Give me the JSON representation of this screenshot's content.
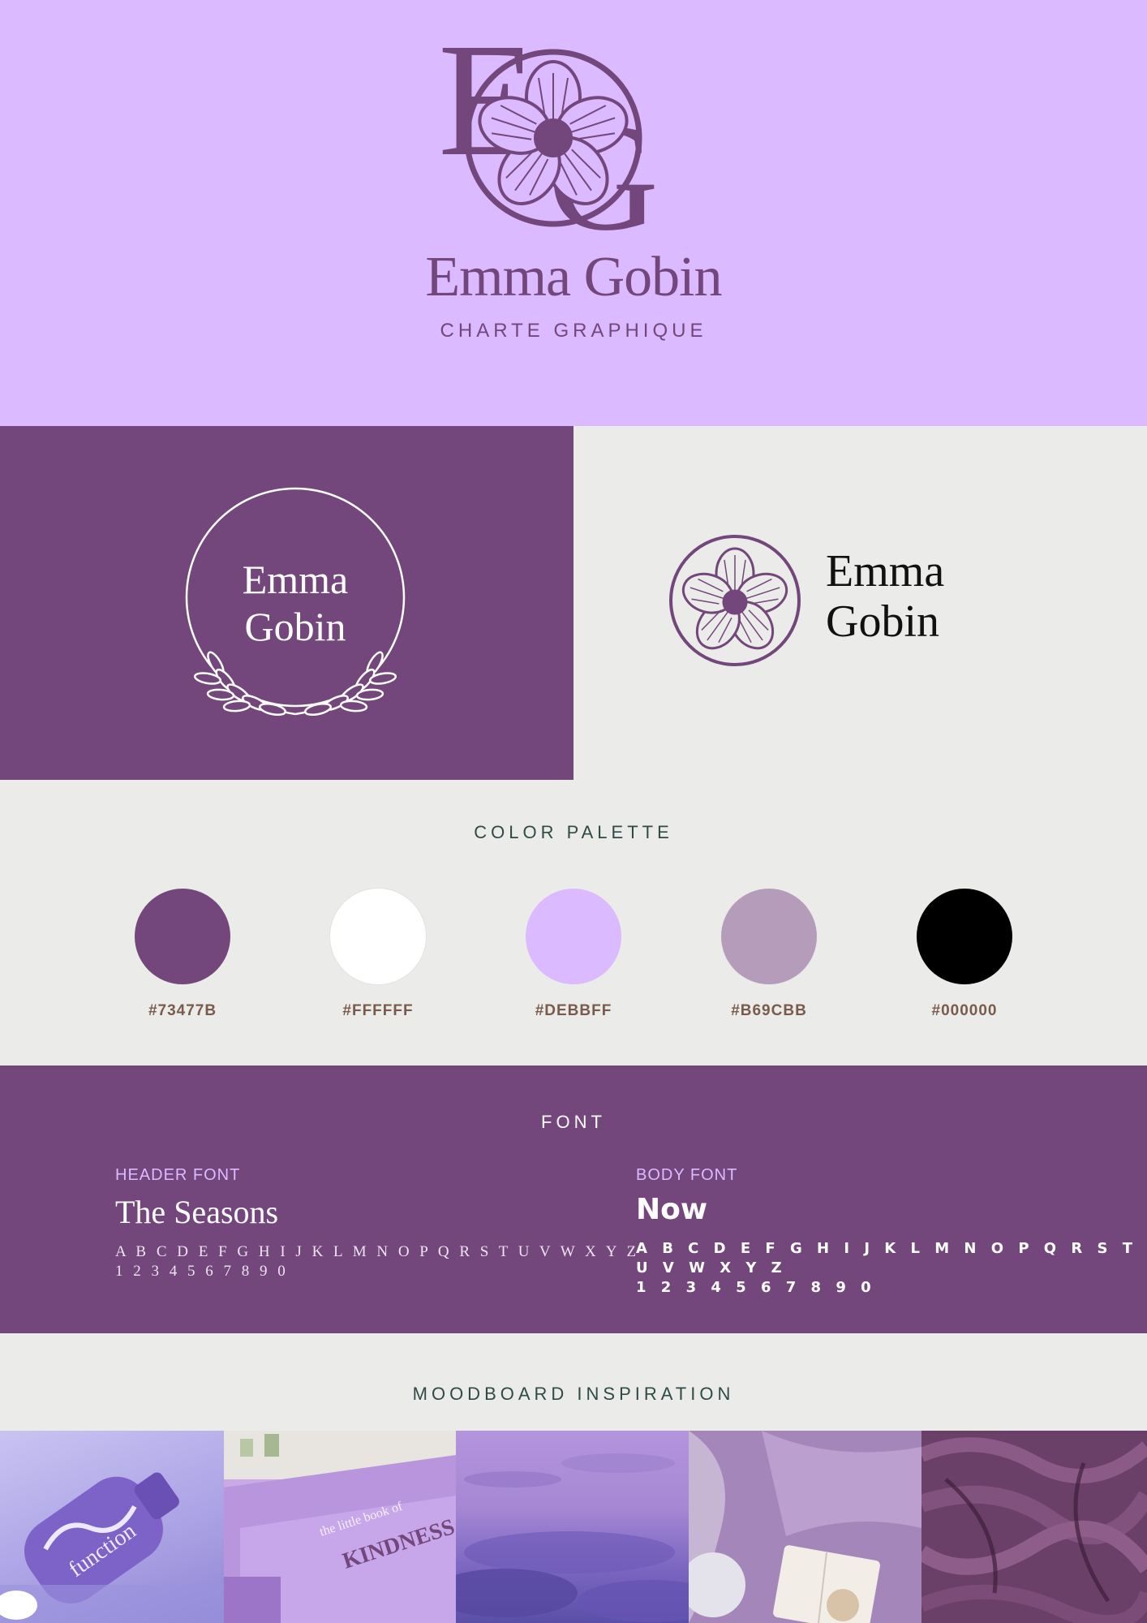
{
  "hero": {
    "monogram_letters": "EG",
    "name": "Emma Gobin",
    "subtitle": "CHARTE GRAPHIQUE"
  },
  "logos": {
    "dark_name_line1": "Emma",
    "dark_name_line2": "Gobin",
    "light_name_line1": "Emma",
    "light_name_line2": "Gobin"
  },
  "palette": {
    "title": "COLOR PALETTE",
    "colors": [
      {
        "hex": "#73477B"
      },
      {
        "hex": "#FFFFFF"
      },
      {
        "hex": "#DEBBFF"
      },
      {
        "hex": "#B69CBB"
      },
      {
        "hex": "#000000"
      }
    ]
  },
  "fonts": {
    "title": "FONT",
    "header": {
      "label": "HEADER FONT",
      "name": "The Seasons",
      "alphabet": "A B C D E F G H I J K L M N O P Q R S T U V W X Y Z",
      "digits": "1 2 3 4 5 6 7 8 9 0"
    },
    "body": {
      "label": "BODY FONT",
      "name": "Now",
      "alphabet": "A B C D E F G H I J K L M N O P Q R S T U V W X Y Z",
      "digits": "1 2 3 4 5 6 7 8 9 0"
    }
  },
  "moodboard": {
    "title": "MOODBOARD INSPIRATION",
    "images": [
      {
        "icon": "lotion-bottle-photo",
        "caption": "function"
      },
      {
        "icon": "books-photo",
        "caption": "the little book of KINDNESS"
      },
      {
        "icon": "sky-photo"
      },
      {
        "icon": "bedding-photo"
      },
      {
        "icon": "fabric-photo"
      }
    ]
  },
  "colors": {
    "primary": "#73477b",
    "lilac": "#dcbaff",
    "mauve": "#b69cbb",
    "light_bg": "#ebebe9"
  }
}
